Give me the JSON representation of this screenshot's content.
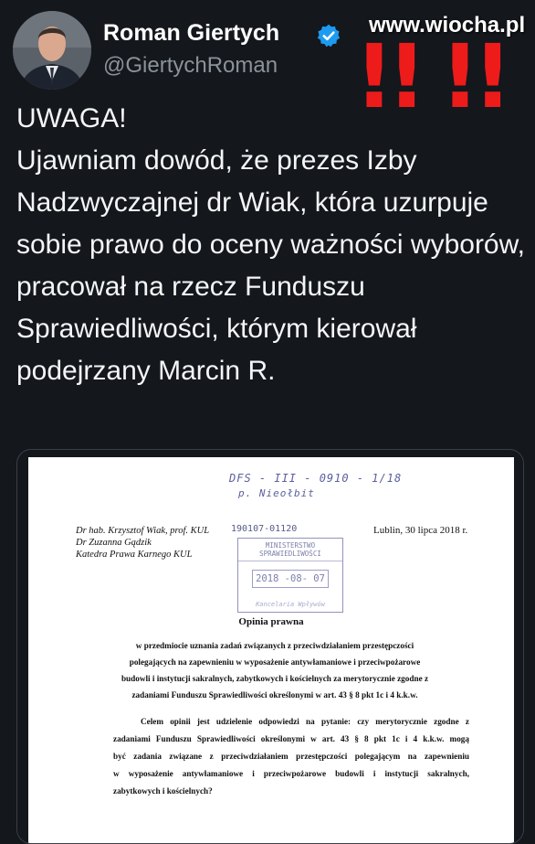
{
  "header": {
    "display_name": "Roman Giertych",
    "handle": "@GiertychRoman",
    "watermark": "www.wiocha.pl",
    "exclamations": "!!",
    "icons": {
      "verified": "verified-badge-icon",
      "avatar": "profile-photo"
    },
    "colors": {
      "verified": "#1d9bf0",
      "exclamation": "#ee1b1b",
      "background": "#14171c",
      "handle": "#8b9299"
    }
  },
  "tweet": {
    "lines": [
      "UWAGA!",
      "Ujawniam dowód, że prezes Izby Nadzwyczajnej dr Wiak, która uzurpuje sobie prawo do oceny ważności wyborów, pracował na rzecz Funduszu Sprawiedliwości, którym kierował podejrzany Marcin R."
    ]
  },
  "document": {
    "handwritten_ref": "DFS - III - 0910 - 1/18",
    "handwritten_name": "p. Nieołbit",
    "authors": [
      "Dr hab. Krzysztof Wiak, prof. KUL",
      "Dr Zuzanna Gądzik",
      "Katedra Prawa Karnego KUL"
    ],
    "registry_hand": "190107-01120",
    "stamp": {
      "title": "MINISTERSTWO SPRAWIEDLIWOŚCI",
      "date": "2018 -08- 07",
      "footer": "Kancelaria Wpływów"
    },
    "city_date": "Lublin, 30 lipca 2018 r.",
    "title": "Opinia prawna",
    "subject_lines": [
      "w przedmiocie uznania zadań związanych z przeciwdziałaniem przestępczości",
      "polegających na zapewnieniu w wyposażenie antywłamaniowe i przeciwpożarowe",
      "budowli i instytucji sakralnych, zabytkowych i kościelnych za merytorycznie zgodne z",
      "zadaniami Funduszu Sprawiedliwości określonymi w art. 43 § 8 pkt 1c i 4 k.k.w."
    ],
    "body_lines": [
      "Celem opinii jest udzielenie odpowiedzi na pytanie: czy merytorycznie zgodne z",
      "zadaniami Funduszu Sprawiedliwości określonymi w art. 43 § 8 pkt 1c i 4 k.k.w. mogą",
      "być zadania związane z przeciwdziałaniem przestępczości polegającym na zapewnieniu",
      "w wyposażenie antywłamaniowe i przeciwpożarowe budowli i instytucji sakralnych,",
      "zabytkowych i kościelnych?"
    ]
  }
}
